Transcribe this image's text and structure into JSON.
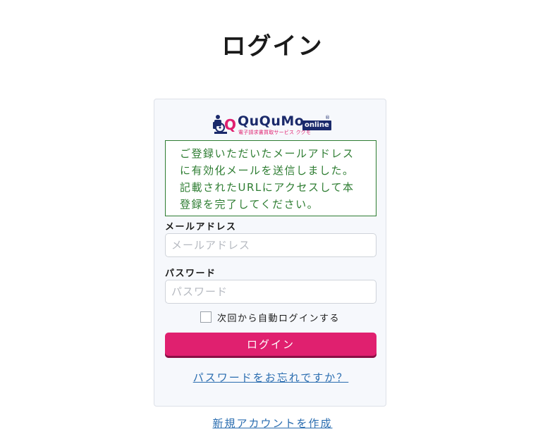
{
  "page": {
    "title": "ログイン"
  },
  "logo": {
    "name": "QuQuMo",
    "badge": "online",
    "tagline": "電子請求書買取サービス ククモ",
    "registered": "®",
    "colors": {
      "navy": "#1b2a6b",
      "pink": "#e0206f"
    }
  },
  "notice": {
    "lines": [
      "ご登録いただいたメールアドレス",
      "に有効化メールを送信しました。",
      "記載されたURLにアクセスして本",
      "登録を完了してください。"
    ],
    "color": "#2e7d32"
  },
  "form": {
    "email_label": "メールアドレス",
    "email_placeholder": "メールアドレス",
    "email_value": "",
    "password_label": "パスワード",
    "password_placeholder": "パスワード",
    "password_value": "",
    "remember_label": "次回から自動ログインする",
    "remember_checked": false,
    "submit_label": "ログイン",
    "submit_color": "#e0206f"
  },
  "links": {
    "forgot_password": "パスワードをお忘れですか？",
    "create_account": "新規アカウントを作成",
    "color": "#2a6db0"
  }
}
